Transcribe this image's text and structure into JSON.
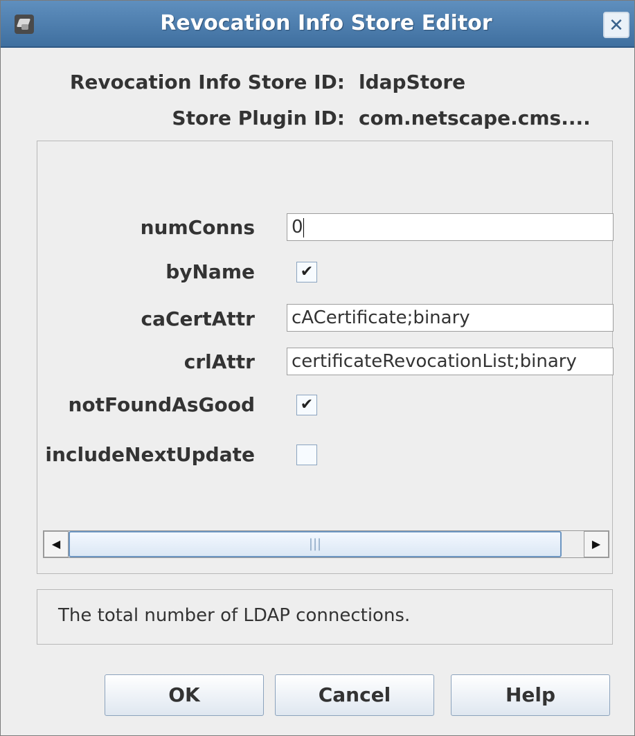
{
  "window": {
    "title": "Revocation Info Store Editor",
    "close_symbol": "✕",
    "app_icon": "certificate-system-icon"
  },
  "header": {
    "store_id_label": "Revocation Info Store ID:",
    "store_id_value": "ldapStore",
    "plugin_id_label": "Store Plugin ID:",
    "plugin_id_value": "com.netscape.cms...."
  },
  "fields": {
    "numConns": {
      "label": "numConns",
      "value": "0"
    },
    "byName": {
      "label": "byName",
      "checked": true,
      "mark": "✔"
    },
    "caCertAttr": {
      "label": "caCertAttr",
      "value": "cACertificate;binary"
    },
    "crlAttr": {
      "label": "crlAttr",
      "value": "certificateRevocationList;binary"
    },
    "notFoundAsGood": {
      "label": "notFoundAsGood",
      "checked": true,
      "mark": "✔"
    },
    "includeNextUpdate": {
      "label": "includeNextUpdate",
      "checked": false,
      "mark": ""
    }
  },
  "scrollbar": {
    "left_arrow": "◀",
    "right_arrow": "▶",
    "grip": "|||"
  },
  "help": {
    "text": "The total number of LDAP connections."
  },
  "buttons": {
    "ok": "OK",
    "cancel": "Cancel",
    "help": "Help"
  }
}
